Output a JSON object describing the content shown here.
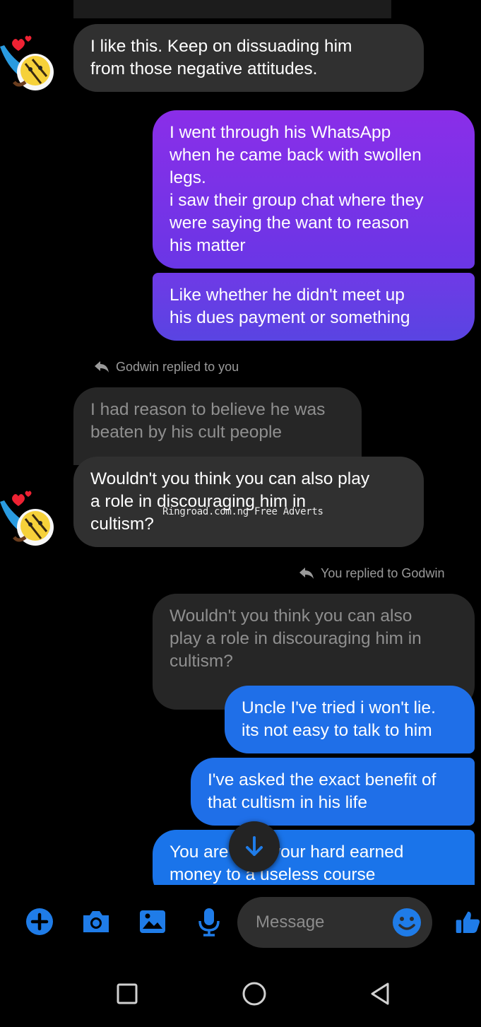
{
  "colors": {
    "accent_blue": "#1f6fe8",
    "purple_top": "#8a2ee8",
    "purple_bottom": "#5944e2",
    "incoming_gray": "#303030",
    "quoted_gray": "#262626"
  },
  "messages": {
    "m1": "I like this. Keep on dissuading him\nfrom those negative attitudes.",
    "m2": "I went through his WhatsApp\nwhen he came back with swollen\nlegs.\ni saw their group chat where they\nwere saying the want to reason\nhis matter",
    "m3": "Like whether he didn't meet up\nhis dues payment or something",
    "reply1_label": "Godwin replied to you",
    "m4_quoted": "I had reason to believe he was\nbeaten by his cult people",
    "m5": "Wouldn't you think you can also play\na role in discouraging him in\ncultism?",
    "reply2_label": "You replied to Godwin",
    "m6_quoted": "Wouldn't you think you can also\nplay a role in discouraging him in\ncultism?",
    "m7": "Uncle I've tried i won't lie.\nits not easy to talk to him",
    "m8": "I've asked the exact benefit of\nthat cultism in his life",
    "m9": "You are      g your hard earned\nmoney to a useless course"
  },
  "watermark": "Ringroad.com.ng Free Adverts",
  "composer": {
    "placeholder": "Message",
    "icons": [
      "plus-icon",
      "camera-icon",
      "image-icon",
      "microphone-icon",
      "emoji-icon",
      "thumbs-up-icon"
    ]
  },
  "navbar": {
    "icons": [
      "recents-square-icon",
      "home-circle-icon",
      "back-triangle-icon"
    ]
  }
}
